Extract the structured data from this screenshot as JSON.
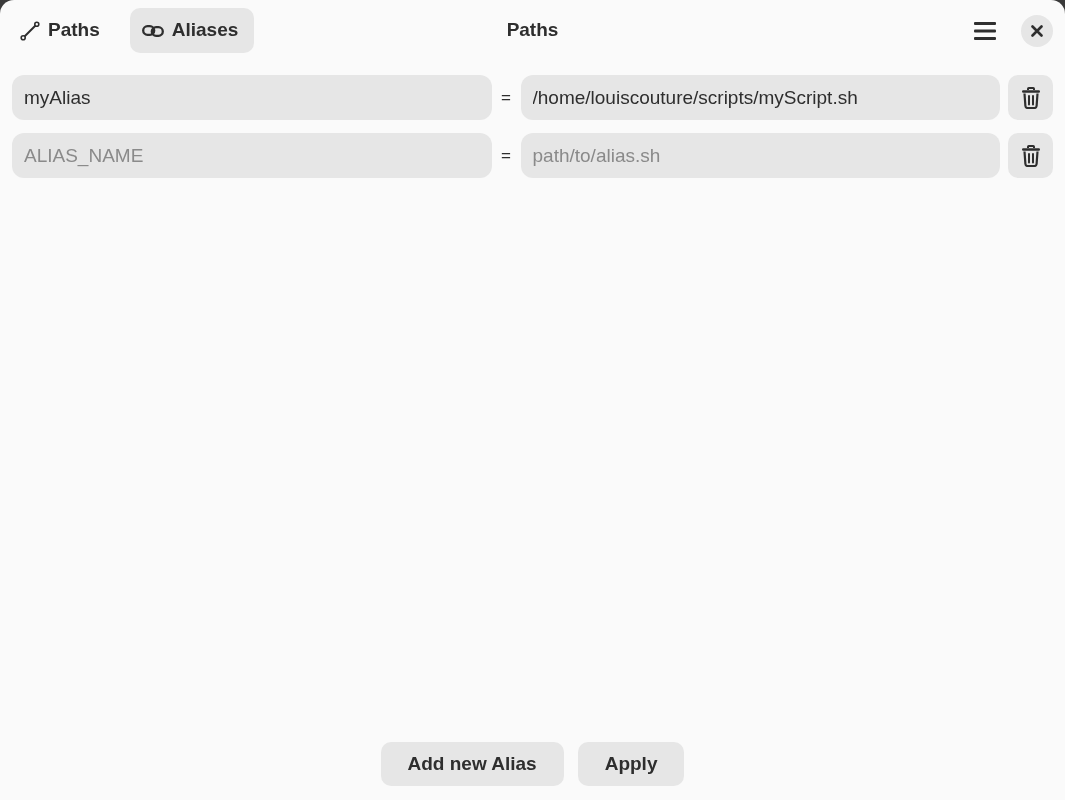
{
  "header": {
    "tabs": [
      {
        "label": "Paths",
        "selected": false
      },
      {
        "label": "Aliases",
        "selected": true
      }
    ],
    "title": "Paths"
  },
  "aliases": [
    {
      "name": {
        "value": "myAlias"
      },
      "operator": "=",
      "path": {
        "value": "/home/louiscouture/scripts/myScript.sh"
      }
    },
    {
      "name": {
        "placeholder": "ALIAS_NAME"
      },
      "operator": "=",
      "path": {
        "placeholder": "path/to/alias.sh"
      }
    }
  ],
  "buttons": [
    "Add new Alias",
    "Apply"
  ]
}
